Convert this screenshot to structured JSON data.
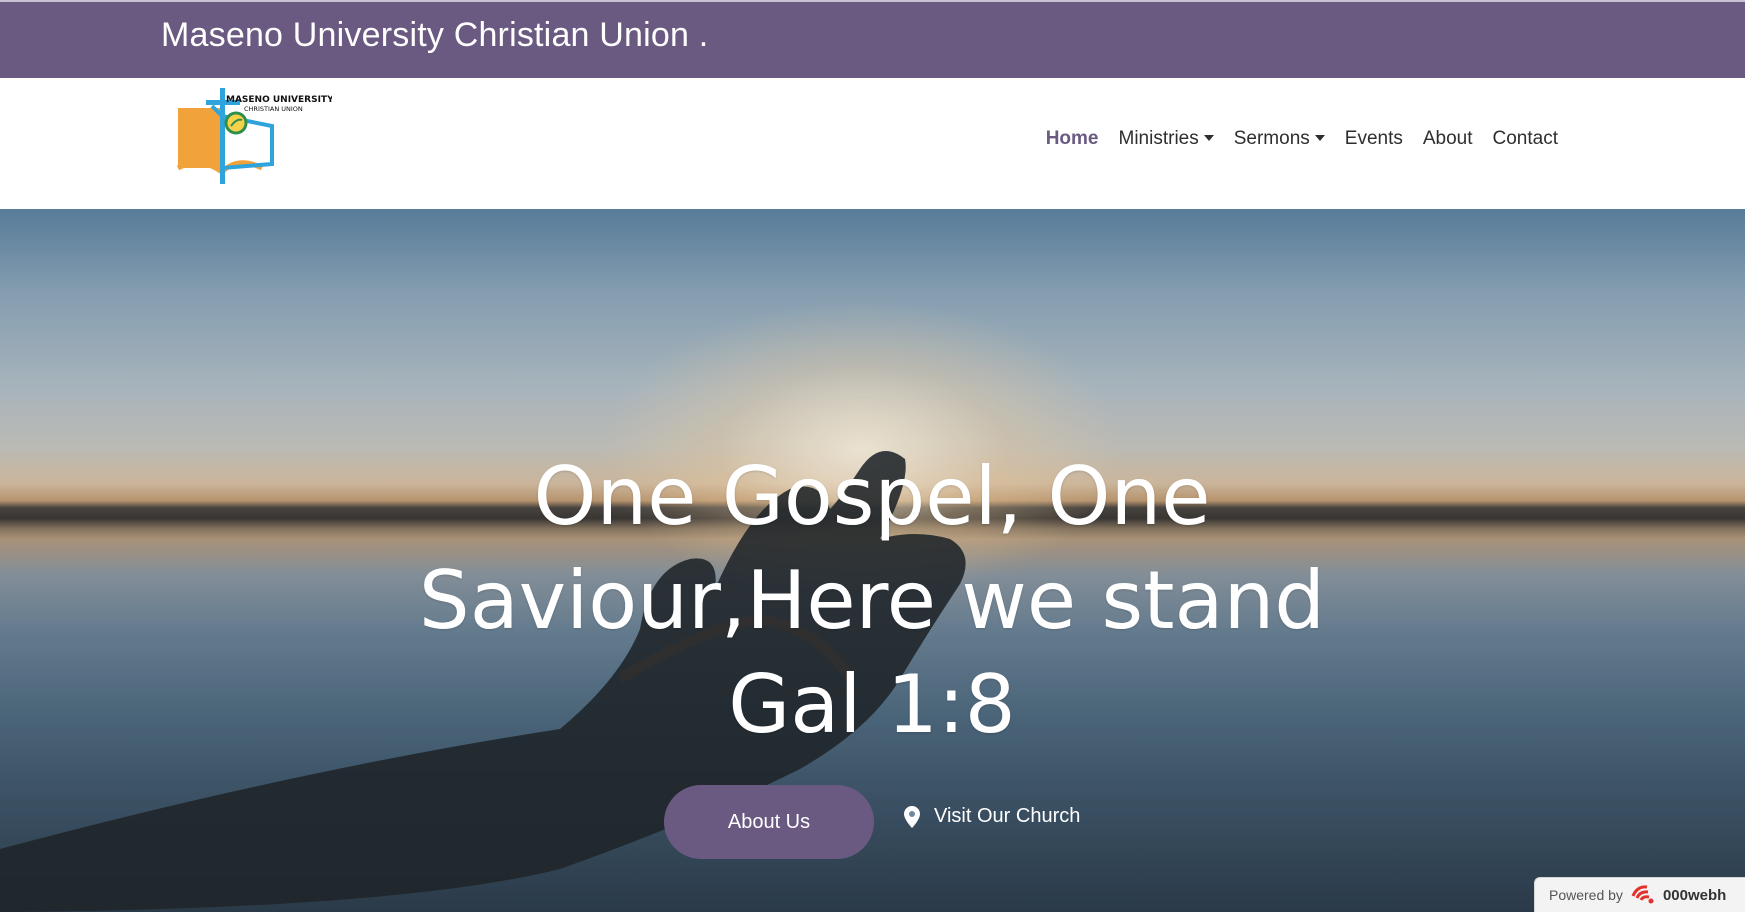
{
  "header": {
    "site_title": "Maseno University Christian Union ."
  },
  "logo": {
    "line1": "MASENO UNIVERSITY",
    "line2": "CHRISTIAN UNION",
    "colors": {
      "orange": "#f2a23a",
      "blue": "#2fa4dc"
    }
  },
  "nav": {
    "items": [
      {
        "label": "Home",
        "active": true
      },
      {
        "label": "Ministries",
        "dropdown": true
      },
      {
        "label": "Sermons",
        "dropdown": true
      },
      {
        "label": "Events"
      },
      {
        "label": "About"
      },
      {
        "label": "Contact"
      }
    ]
  },
  "hero": {
    "headline_line1": "One Gospel, One",
    "headline_line2": "Saviour,Here we stand",
    "headline_line3": "Gal 1:8",
    "primary_button": "About Us",
    "secondary_link": "Visit Our Church",
    "secondary_icon": "map-pin-icon"
  },
  "footer_badge": {
    "prefix": "Powered by",
    "brand": "000webh",
    "icon": "000webhost-icon"
  },
  "colors": {
    "brand_purple": "#6a5a82",
    "text_dark": "#2e2e2e",
    "white": "#ffffff"
  }
}
